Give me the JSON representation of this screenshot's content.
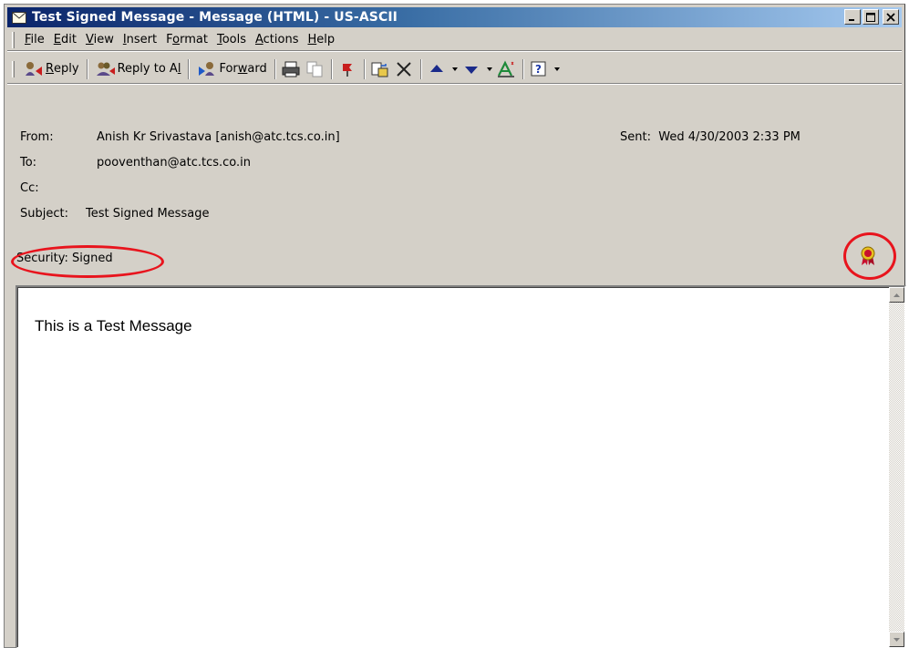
{
  "window": {
    "title": "Test Signed Message - Message (HTML)  - US-ASCII"
  },
  "menu": {
    "items": [
      {
        "key": "F",
        "rest": "ile"
      },
      {
        "key": "E",
        "rest": "dit"
      },
      {
        "key": "V",
        "rest": "iew"
      },
      {
        "key": "I",
        "rest": "nsert"
      },
      {
        "pre": "F",
        "key": "o",
        "rest": "rmat"
      },
      {
        "key": "T",
        "rest": "ools"
      },
      {
        "key": "A",
        "rest": "ctions"
      },
      {
        "key": "H",
        "rest": "elp"
      }
    ]
  },
  "toolbar": {
    "reply_key": "R",
    "reply_rest": "eply",
    "reply_all_pre": "Reply to A",
    "reply_all_key": "l",
    "reply_all_rest": "l",
    "forward_pre": "For",
    "forward_key": "w",
    "forward_rest": "ard"
  },
  "header": {
    "from_label": "From:",
    "from_value": "Anish Kr Srivastava [anish@atc.tcs.co.in]",
    "sent_label": "Sent:",
    "sent_value": "Wed 4/30/2003 2:33 PM",
    "to_label": "To:",
    "to_value": "pooventhan@atc.tcs.co.in",
    "cc_label": "Cc:",
    "cc_value": "",
    "subject_label": "Subject:",
    "subject_value": "Test Signed Message",
    "security_label": "Security:",
    "security_value": "Signed"
  },
  "message": {
    "body": "This is a Test Message"
  },
  "colors": {
    "title_bar": "#0a246a",
    "highlight_oval": "#e8141d",
    "certificate": "#c8102e"
  }
}
